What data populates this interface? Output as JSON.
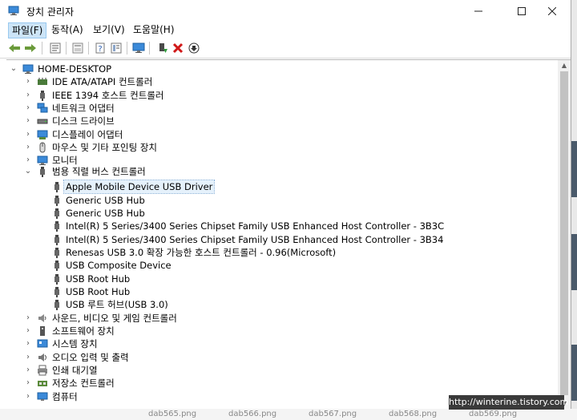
{
  "window": {
    "title": "장치 관리자"
  },
  "menu": [
    "파일(F)",
    "동작(A)",
    "보기(V)",
    "도움말(H)"
  ],
  "toolbar_icons": [
    "back-icon",
    "forward-icon",
    "properties-icon",
    "help-icon",
    "scan-icon",
    "view-icon",
    "monitor-icon",
    "update-driver-icon",
    "uninstall-icon",
    "disable-icon"
  ],
  "tree": {
    "root": "HOME-DESKTOP",
    "categories_before": [
      {
        "label": "IDE ATA/ATAPI 컨트롤러",
        "icon": "ide-controller-icon"
      },
      {
        "label": "IEEE 1394 호스트 컨트롤러",
        "icon": "ieee1394-icon"
      },
      {
        "label": "네트워크 어댑터",
        "icon": "network-adapter-icon"
      },
      {
        "label": "디스크 드라이브",
        "icon": "disk-drive-icon"
      },
      {
        "label": "디스플레이 어댑터",
        "icon": "display-adapter-icon"
      },
      {
        "label": "마우스 및 기타 포인팅 장치",
        "icon": "mouse-icon"
      },
      {
        "label": "모니터",
        "icon": "monitor-icon"
      }
    ],
    "expanded_category": {
      "label": "범용 직렬 버스 컨트롤러",
      "icon": "usb-icon"
    },
    "usb_children": [
      "Apple Mobile Device USB Driver",
      "Generic USB Hub",
      "Generic USB Hub",
      "Intel(R) 5 Series/3400 Series Chipset Family USB Enhanced Host Controller - 3B3C",
      "Intel(R) 5 Series/3400 Series Chipset Family USB Enhanced Host Controller - 3B34",
      "Renesas USB 3.0 확장 가능한 호스트 컨트롤러 - 0.96(Microsoft)",
      "USB Composite Device",
      "USB Root Hub",
      "USB Root Hub",
      "USB 루트 허브(USB 3.0)"
    ],
    "categories_after": [
      {
        "label": "사운드, 비디오 및 게임 컨트롤러",
        "icon": "sound-icon"
      },
      {
        "label": "소프트웨어 장치",
        "icon": "software-device-icon"
      },
      {
        "label": "시스템 장치",
        "icon": "system-device-icon"
      },
      {
        "label": "오디오 입력 및 출력",
        "icon": "audio-icon"
      },
      {
        "label": "인쇄 대기열",
        "icon": "printer-icon"
      },
      {
        "label": "저장소 컨트롤러",
        "icon": "storage-controller-icon"
      },
      {
        "label": "컴퓨터",
        "icon": "computer-icon"
      }
    ]
  },
  "watermark": "http://winterine.tistory.com",
  "bottom_files": [
    "dab565.png",
    "dab566.png",
    "dab567.png",
    "dab568.png",
    "dab569.png"
  ]
}
